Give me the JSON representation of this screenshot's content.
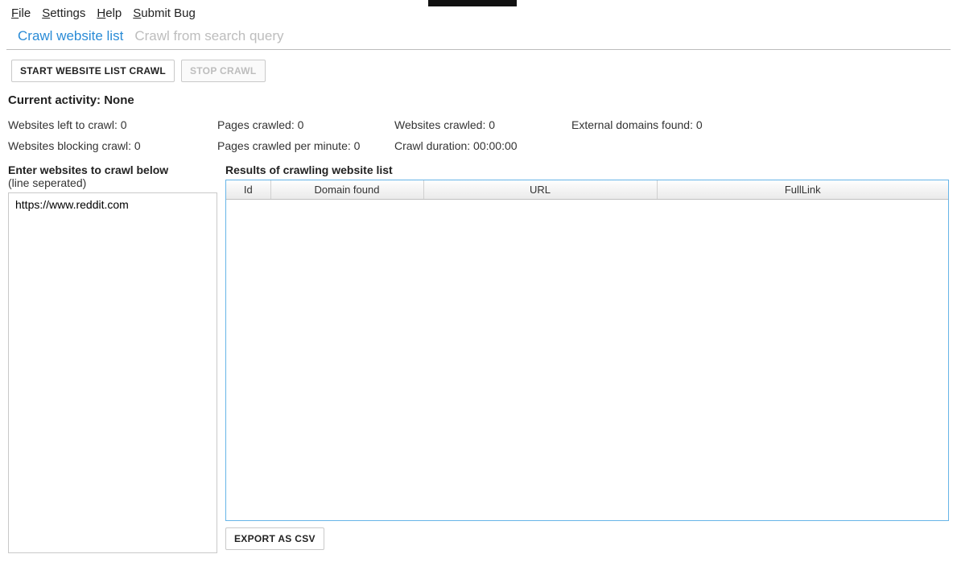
{
  "menubar": {
    "file": "File",
    "settings": "Settings",
    "help": "Help",
    "submit_bug": "Submit Bug"
  },
  "tabs": {
    "crawl_list": "Crawl website list",
    "crawl_search": "Crawl from search query"
  },
  "toolbar": {
    "start": "START WEBSITE LIST CRAWL",
    "stop": "STOP CRAWL"
  },
  "activity": {
    "label_prefix": "Current activity: ",
    "value": "None"
  },
  "stats": {
    "websites_left": "Websites left to crawl: 0",
    "pages_crawled": "Pages crawled: 0",
    "websites_crawled": "Websites crawled: 0",
    "external_domains": "External domains found: 0",
    "websites_blocking": "Websites blocking crawl: 0",
    "pages_per_minute": "Pages crawled per minute: 0",
    "crawl_duration": "Crawl duration: 00:00:00"
  },
  "input_section": {
    "label": "Enter websites to crawl below",
    "sublabel": "(line seperated)",
    "value": "https://www.reddit.com"
  },
  "results_section": {
    "label": "Results of crawling website list",
    "columns": {
      "id": "Id",
      "domain": "Domain found",
      "url": "URL",
      "fulllink": "FullLink"
    },
    "rows": []
  },
  "export": {
    "label": "EXPORT AS CSV"
  }
}
